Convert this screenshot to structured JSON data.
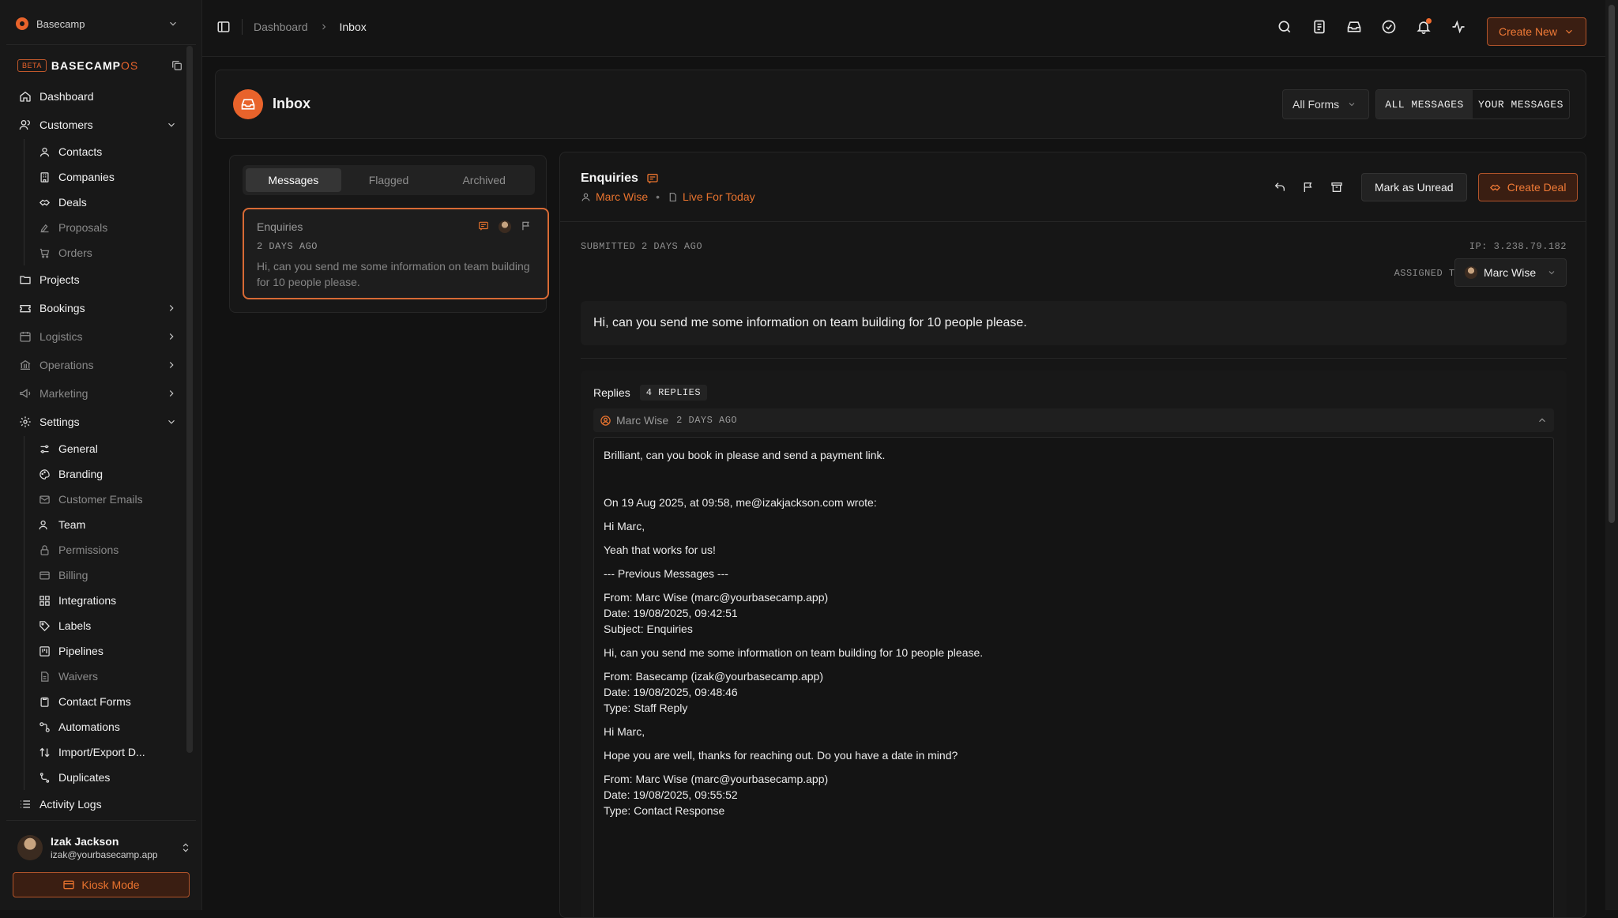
{
  "workspace": {
    "name": "Basecamp"
  },
  "brand": {
    "beta": "BETA",
    "name_main": "BASECAMP",
    "name_suffix": "OS"
  },
  "nav": {
    "dashboard": "Dashboard",
    "customers": "Customers",
    "customers_items": [
      "Contacts",
      "Companies",
      "Deals",
      "Proposals",
      "Orders"
    ],
    "projects": "Projects",
    "bookings": "Bookings",
    "logistics": "Logistics",
    "operations": "Operations",
    "marketing": "Marketing",
    "settings": "Settings",
    "settings_items": [
      "General",
      "Branding",
      "Customer Emails",
      "Team",
      "Permissions",
      "Billing",
      "Integrations",
      "Labels",
      "Pipelines",
      "Waivers",
      "Contact Forms",
      "Automations",
      "Import/Export D...",
      "Duplicates"
    ],
    "activity_logs": "Activity Logs"
  },
  "user": {
    "name": "Izak Jackson",
    "email": "izak@yourbasecamp.app"
  },
  "kiosk": {
    "label": "Kiosk Mode"
  },
  "breadcrumb": {
    "home": "Dashboard",
    "current": "Inbox"
  },
  "topbar": {
    "create_new": "Create New"
  },
  "header": {
    "title": "Inbox",
    "filter": "All Forms",
    "seg_all": "ALL MESSAGES",
    "seg_yours": "YOUR MESSAGES"
  },
  "list": {
    "tabs": [
      "Messages",
      "Flagged",
      "Archived"
    ],
    "message": {
      "title": "Enquiries",
      "date": "2 DAYS AGO",
      "preview": "Hi, can you send me some information on team building for 10 people please."
    }
  },
  "detail": {
    "title": "Enquiries",
    "contact": "Marc Wise",
    "form": "Live For Today",
    "mark_unread": "Mark as Unread",
    "create_deal": "Create Deal",
    "submitted": "SUBMITTED 2 DAYS AGO",
    "ip": "IP: 3.238.79.182",
    "assigned_label": "ASSIGNED TO:",
    "assigned_to": "Marc Wise",
    "message": "Hi, can you send me some information on team building for 10 people please.",
    "replies_label": "Replies",
    "replies_count": "4 REPLIES",
    "reply": {
      "author": "Marc Wise",
      "time": "2 DAYS AGO",
      "lines": [
        "Brilliant, can you book in please and send a payment link.",
        "On 19 Aug 2025, at 09:58, me@izakjackson.com wrote:",
        "Hi Marc,",
        "Yeah that works for us!",
        "--- Previous Messages ---",
        "From: Marc Wise (marc@yourbasecamp.app)",
        "Date: 19/08/2025, 09:42:51",
        "Subject: Enquiries",
        "Hi, can you send me some information on team building for 10 people please.",
        "From: Basecamp (izak@yourbasecamp.app)",
        "Date: 19/08/2025, 09:48:46",
        "Type: Staff Reply",
        "Hi Marc,",
        "Hope you are well, thanks for reaching out. Do you have a date in mind?",
        "From: Marc Wise (marc@yourbasecamp.app)",
        "Date: 19/08/2025, 09:55:52",
        "Type: Contact Response"
      ]
    }
  },
  "colors": {
    "accent": "#e8632b",
    "bg": "#121212",
    "panel": "#171717"
  }
}
